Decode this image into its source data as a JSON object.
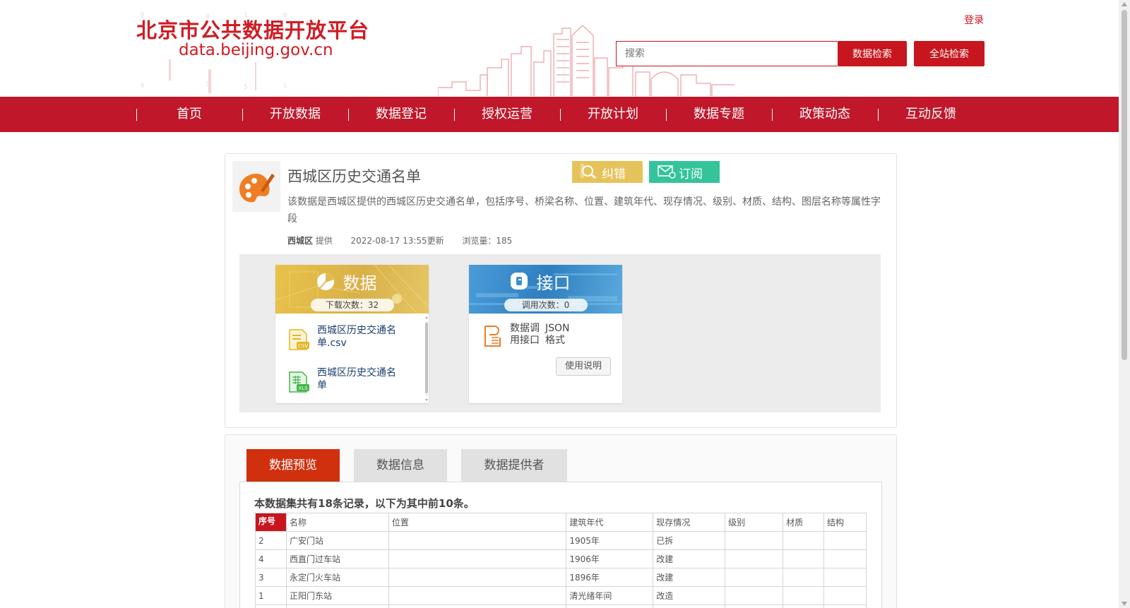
{
  "header": {
    "logo_cn": "北京市公共数据开放平台",
    "logo_en": "data.beijing.gov.cn",
    "login": "登录",
    "search_placeholder": "搜索",
    "data_search_btn": "数据检索",
    "site_search_btn": "全站检索"
  },
  "nav": {
    "items": [
      "首页",
      "开放数据",
      "数据登记",
      "授权运营",
      "开放计划",
      "数据专题",
      "政策动态",
      "互动反馈"
    ]
  },
  "dataset": {
    "title": "西城区历史交通名单",
    "correct_btn": "纠错",
    "subscribe_btn": "订阅",
    "description": "该数据是西城区提供的西城区历史交通名单，包括序号、桥梁名称、位置、建筑年代、现存情况、级别、材质、结构、图层名称等属性字段",
    "provider": "西城区",
    "provider_suffix": "提供",
    "updated": "2022-08-17 13:55更新",
    "views": "浏览量：185"
  },
  "resources": {
    "data": {
      "title": "数据",
      "count": "下载次数：32",
      "files": [
        {
          "name": "西城区历史交通名单.csv",
          "type": "csv-file-icon"
        },
        {
          "name": "西城区历史交通名单",
          "type": "xls-file-icon"
        }
      ]
    },
    "api": {
      "title": "接口",
      "count": "调用次数：0",
      "label": "数据调用接口",
      "format": "JSON格式",
      "help_btn": "使用说明"
    }
  },
  "tabs": [
    {
      "label": "数据预览",
      "active": true
    },
    {
      "label": "数据信息",
      "active": false
    },
    {
      "label": "数据提供者",
      "active": false
    }
  ],
  "preview": {
    "note": "本数据集共有18条记录，以下为其中前10条。",
    "columns": [
      "序号",
      "名称",
      "位置",
      "建筑年代",
      "现存情况",
      "级别",
      "材质",
      "结构"
    ],
    "rows": [
      [
        "2",
        "广安门站",
        "",
        "1905年",
        "已拆",
        "",
        "",
        ""
      ],
      [
        "4",
        "西直门过车站",
        "",
        "1906年",
        "改建",
        "",
        "",
        ""
      ],
      [
        "3",
        "永定门火车站",
        "",
        "1896年",
        "改建",
        "",
        "",
        ""
      ],
      [
        "1",
        "正阳门东站",
        "",
        "清光绪年间",
        "改造",
        "",
        "",
        ""
      ]
    ]
  },
  "colors": {
    "brand_red": "#c0172a",
    "tab_active": "#d0300e",
    "correct_yellow": "#e6c35a",
    "subscribe_green": "#35c39b"
  }
}
